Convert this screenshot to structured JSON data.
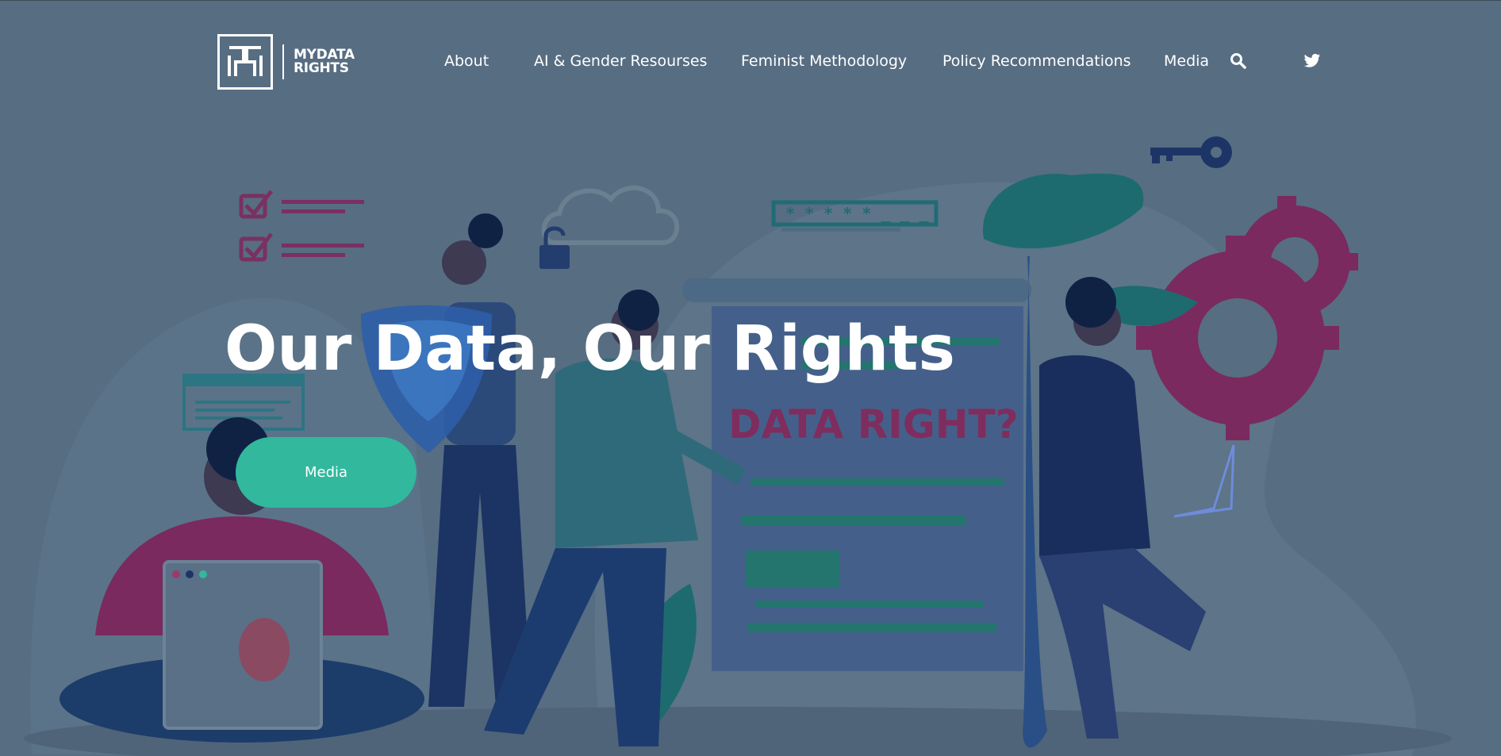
{
  "brand": {
    "logo_line1": "MYDATA",
    "logo_line2": "RIGHTS"
  },
  "nav": {
    "items": [
      {
        "label": "About"
      },
      {
        "label": "AI & Gender Resourses"
      },
      {
        "label": "Feminist Methodology"
      },
      {
        "label": "Policy Recommendations"
      },
      {
        "label": "Media"
      }
    ],
    "search_icon": "search-icon",
    "social_icon": "twitter-icon"
  },
  "hero": {
    "title": "Our Data, Our Rights",
    "button_label": "Media",
    "poster_text": "DATA RIGHT?",
    "password_text": "* * * * * _ _ _"
  },
  "colors": {
    "background": "#576d82",
    "accent_green": "#31b89d",
    "accent_magenta": "#7f2d5e",
    "teal": "#216b74",
    "navy": "#1d3566"
  }
}
